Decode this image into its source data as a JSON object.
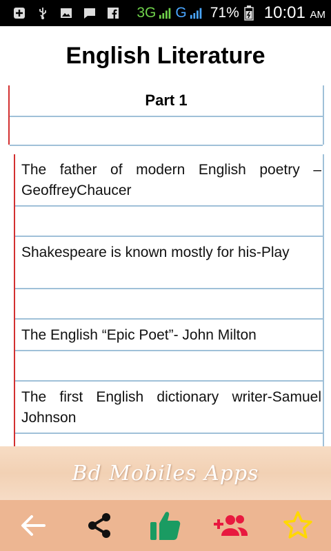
{
  "status_bar": {
    "network_primary": "3G",
    "network_secondary": "G",
    "battery": "71%",
    "time": "10:01",
    "ampm": "AM",
    "icons": [
      "add-box-icon",
      "usb-icon",
      "image-icon",
      "message-icon",
      "facebook-icon",
      "signal-icon",
      "battery-icon"
    ]
  },
  "header": {
    "title": "English Literature"
  },
  "part": {
    "label": "Part 1"
  },
  "items": [
    {
      "text": "The father of modern English poetry – GeoffreyChaucer"
    },
    {
      "text": "Shakespeare is known mostly for his-Play"
    },
    {
      "text": "The English “Epic Poet”- John Milton"
    },
    {
      "text": "The first English dictionary writer-Samuel Johnson"
    }
  ],
  "banner": {
    "text": "Bd Mobiles Apps"
  },
  "bottom_nav": {
    "icons": [
      "back-arrow-icon",
      "share-icon",
      "thumbs-up-icon",
      "add-user-icon",
      "star-icon"
    ],
    "colors": {
      "back": "#ffffff",
      "share": "#111111",
      "like": "#1a9b62",
      "add_user": "#e8193f",
      "star": "#ffd800"
    }
  },
  "colors": {
    "accent_red": "#d32f2f",
    "line_blue": "#9fc0d8",
    "nav_bg": "#edb692"
  }
}
